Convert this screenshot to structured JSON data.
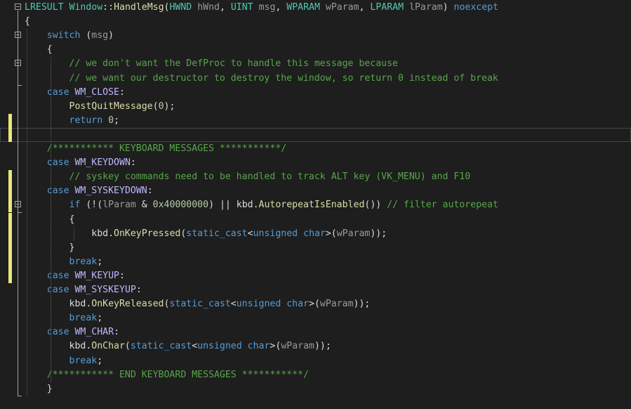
{
  "colors": {
    "background": "#1e1e1e",
    "change_bar": "#e8e87a",
    "keyword": "#569cd6",
    "type": "#4ec9b0",
    "function": "#dcdcaa",
    "parameter": "#9a9a9a",
    "macro": "#beb7ff",
    "comment": "#57a64a",
    "number": "#b5cea8",
    "text": "#dcdcdc"
  },
  "editor": {
    "lines": [
      {
        "name": "code-line-function-signature",
        "tokens": [
          {
            "c": "ty",
            "t": "LRESULT"
          },
          {
            "c": "df",
            "t": " "
          },
          {
            "c": "ty",
            "t": "Window"
          },
          {
            "c": "df",
            "t": "::"
          },
          {
            "c": "fn",
            "t": "HandleMsg"
          },
          {
            "c": "df",
            "t": "("
          },
          {
            "c": "ty",
            "t": "HWND"
          },
          {
            "c": "df",
            "t": " "
          },
          {
            "c": "pr",
            "t": "hWnd"
          },
          {
            "c": "df",
            "t": ", "
          },
          {
            "c": "ty",
            "t": "UINT"
          },
          {
            "c": "df",
            "t": " "
          },
          {
            "c": "pr",
            "t": "msg"
          },
          {
            "c": "df",
            "t": ", "
          },
          {
            "c": "ty",
            "t": "WPARAM"
          },
          {
            "c": "df",
            "t": " "
          },
          {
            "c": "pr",
            "t": "wParam"
          },
          {
            "c": "df",
            "t": ", "
          },
          {
            "c": "ty",
            "t": "LPARAM"
          },
          {
            "c": "df",
            "t": " "
          },
          {
            "c": "pr",
            "t": "lParam"
          },
          {
            "c": "df",
            "t": ") "
          },
          {
            "c": "kw",
            "t": "noexcept"
          }
        ]
      },
      {
        "name": "code-line-open-brace",
        "tokens": [
          {
            "c": "df",
            "t": "{"
          }
        ]
      },
      {
        "name": "code-line-switch",
        "tokens": [
          {
            "c": "df",
            "t": "    "
          },
          {
            "c": "kw",
            "t": "switch"
          },
          {
            "c": "df",
            "t": " ("
          },
          {
            "c": "pr",
            "t": "msg"
          },
          {
            "c": "df",
            "t": ")"
          }
        ]
      },
      {
        "name": "code-line-switch-open-brace",
        "tokens": [
          {
            "c": "df",
            "t": "    {"
          }
        ]
      },
      {
        "name": "code-line-comment",
        "tokens": [
          {
            "c": "df",
            "t": "        "
          },
          {
            "c": "cm",
            "t": "// we don't want the DefProc to handle this message because"
          }
        ]
      },
      {
        "name": "code-line-comment",
        "tokens": [
          {
            "c": "df",
            "t": "        "
          },
          {
            "c": "cm",
            "t": "// we want our destructor to destroy the window, so return 0 instead of break"
          }
        ]
      },
      {
        "name": "code-line-case-wm-close",
        "tokens": [
          {
            "c": "df",
            "t": "    "
          },
          {
            "c": "kw",
            "t": "case"
          },
          {
            "c": "df",
            "t": " "
          },
          {
            "c": "mc",
            "t": "WM_CLOSE"
          },
          {
            "c": "df",
            "t": ":"
          }
        ]
      },
      {
        "name": "code-line-post-quit-message",
        "tokens": [
          {
            "c": "df",
            "t": "        "
          },
          {
            "c": "fn",
            "t": "PostQuitMessage"
          },
          {
            "c": "df",
            "t": "("
          },
          {
            "c": "nm",
            "t": "0"
          },
          {
            "c": "df",
            "t": ");"
          }
        ]
      },
      {
        "name": "code-line-return",
        "tokens": [
          {
            "c": "df",
            "t": "        "
          },
          {
            "c": "kw",
            "t": "return"
          },
          {
            "c": "df",
            "t": " "
          },
          {
            "c": "nm",
            "t": "0"
          },
          {
            "c": "df",
            "t": ";"
          }
        ]
      },
      {
        "name": "code-line-empty",
        "tokens": []
      },
      {
        "name": "code-line-comment-keyboard-messages",
        "tokens": [
          {
            "c": "df",
            "t": "    "
          },
          {
            "c": "cm",
            "t": "/*********** KEYBOARD MESSAGES ***********/"
          }
        ]
      },
      {
        "name": "code-line-case-wm-keydown",
        "tokens": [
          {
            "c": "df",
            "t": "    "
          },
          {
            "c": "kw",
            "t": "case"
          },
          {
            "c": "df",
            "t": " "
          },
          {
            "c": "mc",
            "t": "WM_KEYDOWN"
          },
          {
            "c": "df",
            "t": ":"
          }
        ]
      },
      {
        "name": "code-line-comment",
        "tokens": [
          {
            "c": "df",
            "t": "        "
          },
          {
            "c": "cm",
            "t": "// syskey commands need to be handled to track ALT key (VK_MENU) and F10"
          }
        ]
      },
      {
        "name": "code-line-case-wm-syskeydown",
        "tokens": [
          {
            "c": "df",
            "t": "    "
          },
          {
            "c": "kw",
            "t": "case"
          },
          {
            "c": "df",
            "t": " "
          },
          {
            "c": "mc",
            "t": "WM_SYSKEYDOWN"
          },
          {
            "c": "df",
            "t": ":"
          }
        ]
      },
      {
        "name": "code-line-if-autorepeat",
        "tokens": [
          {
            "c": "df",
            "t": "        "
          },
          {
            "c": "kw",
            "t": "if"
          },
          {
            "c": "df",
            "t": " (!("
          },
          {
            "c": "pr",
            "t": "lParam"
          },
          {
            "c": "df",
            "t": " & "
          },
          {
            "c": "nm",
            "t": "0x40000000"
          },
          {
            "c": "df",
            "t": ") || kbd."
          },
          {
            "c": "fn",
            "t": "AutorepeatIsEnabled"
          },
          {
            "c": "df",
            "t": "()) "
          },
          {
            "c": "cm",
            "t": "// filter autorepeat"
          }
        ]
      },
      {
        "name": "code-line-if-open-brace",
        "tokens": [
          {
            "c": "df",
            "t": "        {"
          }
        ]
      },
      {
        "name": "code-line-on-key-pressed",
        "tokens": [
          {
            "c": "df",
            "t": "            kbd."
          },
          {
            "c": "fn",
            "t": "OnKeyPressed"
          },
          {
            "c": "df",
            "t": "("
          },
          {
            "c": "kw",
            "t": "static_cast"
          },
          {
            "c": "df",
            "t": "<"
          },
          {
            "c": "kw",
            "t": "unsigned"
          },
          {
            "c": "df",
            "t": " "
          },
          {
            "c": "kw",
            "t": "char"
          },
          {
            "c": "df",
            "t": ">("
          },
          {
            "c": "pr",
            "t": "wParam"
          },
          {
            "c": "df",
            "t": "));"
          }
        ]
      },
      {
        "name": "code-line-if-close-brace",
        "tokens": [
          {
            "c": "df",
            "t": "        }"
          }
        ]
      },
      {
        "name": "code-line-break",
        "tokens": [
          {
            "c": "df",
            "t": "        "
          },
          {
            "c": "kw",
            "t": "break"
          },
          {
            "c": "df",
            "t": ";"
          }
        ]
      },
      {
        "name": "code-line-case-wm-keyup",
        "tokens": [
          {
            "c": "df",
            "t": "    "
          },
          {
            "c": "kw",
            "t": "case"
          },
          {
            "c": "df",
            "t": " "
          },
          {
            "c": "mc",
            "t": "WM_KEYUP"
          },
          {
            "c": "df",
            "t": ":"
          }
        ]
      },
      {
        "name": "code-line-case-wm-syskeyup",
        "tokens": [
          {
            "c": "df",
            "t": "    "
          },
          {
            "c": "kw",
            "t": "case"
          },
          {
            "c": "df",
            "t": " "
          },
          {
            "c": "mc",
            "t": "WM_SYSKEYUP"
          },
          {
            "c": "df",
            "t": ":"
          }
        ]
      },
      {
        "name": "code-line-on-key-released",
        "tokens": [
          {
            "c": "df",
            "t": "        kbd."
          },
          {
            "c": "fn",
            "t": "OnKeyReleased"
          },
          {
            "c": "df",
            "t": "("
          },
          {
            "c": "kw",
            "t": "static_cast"
          },
          {
            "c": "df",
            "t": "<"
          },
          {
            "c": "kw",
            "t": "unsigned"
          },
          {
            "c": "df",
            "t": " "
          },
          {
            "c": "kw",
            "t": "char"
          },
          {
            "c": "df",
            "t": ">("
          },
          {
            "c": "pr",
            "t": "wParam"
          },
          {
            "c": "df",
            "t": "));"
          }
        ]
      },
      {
        "name": "code-line-break",
        "tokens": [
          {
            "c": "df",
            "t": "        "
          },
          {
            "c": "kw",
            "t": "break"
          },
          {
            "c": "df",
            "t": ";"
          }
        ]
      },
      {
        "name": "code-line-case-wm-char",
        "tokens": [
          {
            "c": "df",
            "t": "    "
          },
          {
            "c": "kw",
            "t": "case"
          },
          {
            "c": "df",
            "t": " "
          },
          {
            "c": "mc",
            "t": "WM_CHAR"
          },
          {
            "c": "df",
            "t": ":"
          }
        ]
      },
      {
        "name": "code-line-on-char",
        "tokens": [
          {
            "c": "df",
            "t": "        kbd."
          },
          {
            "c": "fn",
            "t": "OnChar"
          },
          {
            "c": "df",
            "t": "("
          },
          {
            "c": "kw",
            "t": "static_cast"
          },
          {
            "c": "df",
            "t": "<"
          },
          {
            "c": "kw",
            "t": "unsigned"
          },
          {
            "c": "df",
            "t": " "
          },
          {
            "c": "kw",
            "t": "char"
          },
          {
            "c": "df",
            "t": ">("
          },
          {
            "c": "pr",
            "t": "wParam"
          },
          {
            "c": "df",
            "t": "));"
          }
        ]
      },
      {
        "name": "code-line-break",
        "tokens": [
          {
            "c": "df",
            "t": "        "
          },
          {
            "c": "kw",
            "t": "break"
          },
          {
            "c": "df",
            "t": ";"
          }
        ]
      },
      {
        "name": "code-line-comment-end-keyboard-messages",
        "tokens": [
          {
            "c": "df",
            "t": "    "
          },
          {
            "c": "cm",
            "t": "/*********** END KEYBOARD MESSAGES ***********/"
          }
        ]
      },
      {
        "name": "code-line-switch-close-brace",
        "tokens": [
          {
            "c": "df",
            "t": "    }"
          }
        ]
      }
    ]
  }
}
